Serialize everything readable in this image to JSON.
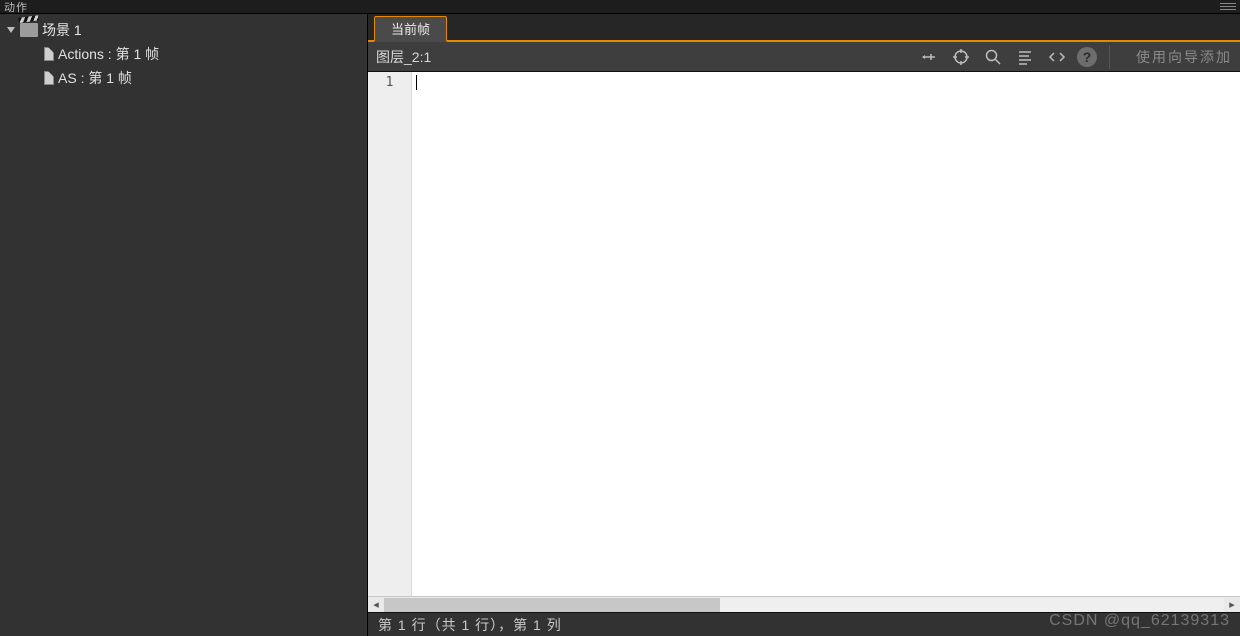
{
  "panel": {
    "title": "动作"
  },
  "tree": {
    "root": {
      "label": "场景 1"
    },
    "children": [
      {
        "label": "Actions : 第 1 帧"
      },
      {
        "label": "AS : 第 1 帧"
      }
    ]
  },
  "tabs": {
    "active_label": "当前帧"
  },
  "toolbar": {
    "layer_label": "图层_2:1",
    "wizard_hint": "使用向导添加"
  },
  "editor": {
    "first_line_number": "1",
    "content": ""
  },
  "status": {
    "text": "第 1 行（共 1 行），第 1 列"
  },
  "watermark": "CSDN @qq_62139313"
}
